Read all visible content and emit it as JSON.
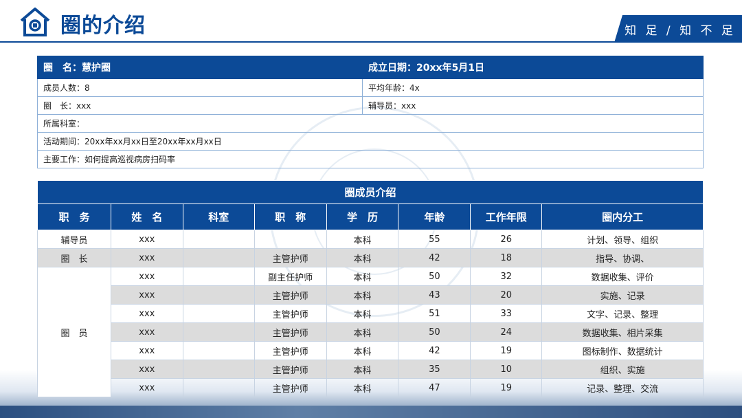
{
  "header": {
    "title": "圈的介绍",
    "slogan": "知 足 / 知 不 足"
  },
  "info": {
    "name_label": "圈　名：",
    "name_value": "慧护圈",
    "founded_label": "成立日期：",
    "founded_value": "20xx年5月1日",
    "members_label": "成员人数：",
    "members_value": "8",
    "avg_age_label": "平均年龄：",
    "avg_age_value": "4x",
    "leader_label": "圈　长：",
    "leader_value": "xxx",
    "advisor_label": "辅导员：",
    "advisor_value": "xxx",
    "dept_label": "所属科室：",
    "dept_value": "",
    "period_label": "活动期间：",
    "period_value": "20xx年xx月xx日至20xx年xx月xx日",
    "work_label": "主要工作：",
    "work_value": "如何提高巡视病房扫码率"
  },
  "members_table": {
    "caption": "圈成员介绍",
    "columns": [
      "职　务",
      "姓　名",
      "科室",
      "职　称",
      "学　历",
      "年龄",
      "工作年限",
      "圈内分工"
    ],
    "rows": [
      {
        "role": "辅导员",
        "name": "xxx",
        "dept": "",
        "title": "",
        "edu": "本科",
        "age": "55",
        "years": "26",
        "duty": "计划、领导、组织"
      },
      {
        "role": "圈　长",
        "name": "xxx",
        "dept": "",
        "title": "主管护师",
        "edu": "本科",
        "age": "42",
        "years": "18",
        "duty": "指导、协调、"
      },
      {
        "role": "圈　员",
        "name": "xxx",
        "dept": "",
        "title": "副主任护师",
        "edu": "本科",
        "age": "50",
        "years": "32",
        "duty": "数据收集、评价"
      },
      {
        "name": "xxx",
        "dept": "",
        "title": "主管护师",
        "edu": "本科",
        "age": "43",
        "years": "20",
        "duty": "实施、记录"
      },
      {
        "name": "xxx",
        "dept": "",
        "title": "主管护师",
        "edu": "本科",
        "age": "51",
        "years": "33",
        "duty": "文字、记录、整理"
      },
      {
        "name": "xxx",
        "dept": "",
        "title": "主管护师",
        "edu": "本科",
        "age": "50",
        "years": "24",
        "duty": "数据收集、相片采集"
      },
      {
        "name": "xxx",
        "dept": "",
        "title": "主管护师",
        "edu": "本科",
        "age": "42",
        "years": "19",
        "duty": "图标制作、数据统计"
      },
      {
        "name": "xxx",
        "dept": "",
        "title": "主管护师",
        "edu": "本科",
        "age": "35",
        "years": "10",
        "duty": "组织、实施"
      },
      {
        "name": "xxx",
        "dept": "",
        "title": "主管护师",
        "edu": "本科",
        "age": "47",
        "years": "19",
        "duty": "记录、整理、交流"
      }
    ]
  },
  "colors": {
    "primary": "#0c4a97",
    "stripe": "#dcdcdc"
  }
}
